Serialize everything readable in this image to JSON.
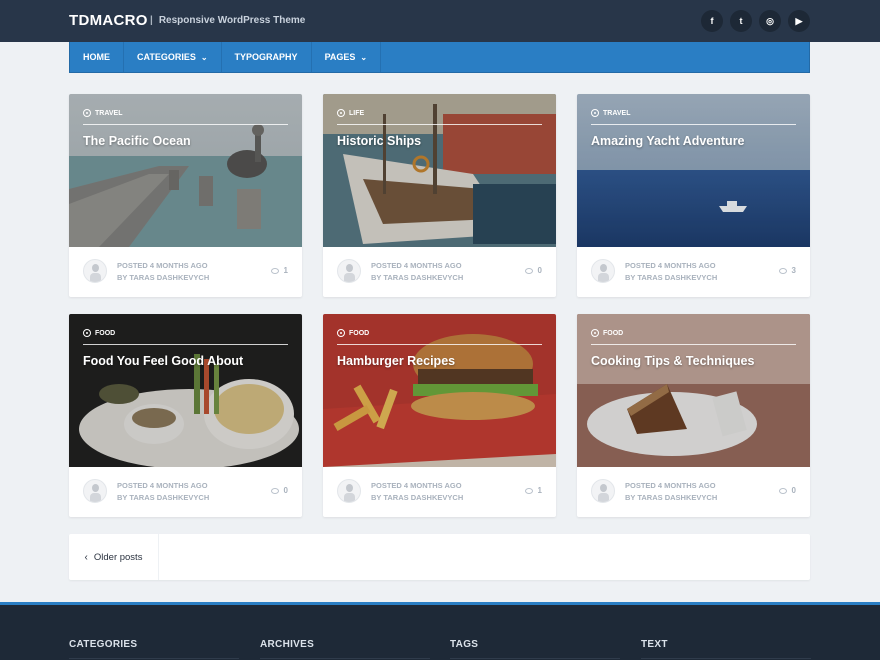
{
  "header": {
    "logo": "TDMACRO",
    "separator": "|",
    "tagline": "Responsive WordPress Theme",
    "socials": [
      {
        "icon": "facebook-icon",
        "glyph": "f"
      },
      {
        "icon": "twitter-icon",
        "glyph": "t"
      },
      {
        "icon": "instagram-icon",
        "glyph": "◎"
      },
      {
        "icon": "youtube-icon",
        "glyph": "▶"
      }
    ]
  },
  "nav": {
    "items": [
      {
        "label": "HOME",
        "dropdown": false
      },
      {
        "label": "CATEGORIES",
        "dropdown": true
      },
      {
        "label": "TYPOGRAPHY",
        "dropdown": false
      },
      {
        "label": "PAGES",
        "dropdown": true
      }
    ],
    "chevron": "⌄"
  },
  "posts": [
    {
      "category": "TRAVEL",
      "title": "The Pacific Ocean",
      "posted": "POSTED 4 MONTHS AGO",
      "author": "BY TARAS DASHKEVYCH",
      "comments": "1"
    },
    {
      "category": "LIFE",
      "title": "Historic Ships",
      "posted": "POSTED 4 MONTHS AGO",
      "author": "BY TARAS DASHKEVYCH",
      "comments": "0"
    },
    {
      "category": "TRAVEL",
      "title": "Amazing Yacht Adventure",
      "posted": "POSTED 4 MONTHS AGO",
      "author": "BY TARAS DASHKEVYCH",
      "comments": "3"
    },
    {
      "category": "FOOD",
      "title": "Food You Feel Good About",
      "posted": "POSTED 4 MONTHS AGO",
      "author": "BY TARAS DASHKEVYCH",
      "comments": "0"
    },
    {
      "category": "FOOD",
      "title": "Hamburger Recipes",
      "posted": "POSTED 4 MONTHS AGO",
      "author": "BY TARAS DASHKEVYCH",
      "comments": "1"
    },
    {
      "category": "FOOD",
      "title": "Cooking Tips & Techniques",
      "posted": "POSTED 4 MONTHS AGO",
      "author": "BY TARAS DASHKEVYCH",
      "comments": "0"
    }
  ],
  "pagination": {
    "older_label": "Older posts",
    "arrow": "‹"
  },
  "footer": {
    "columns": [
      "CATEGORIES",
      "ARCHIVES",
      "TAGS",
      "TEXT"
    ]
  },
  "colors": {
    "topbar": "#283649",
    "nav": "#2a7ec4",
    "footer": "#1e2937",
    "background": "#eef1f4"
  }
}
